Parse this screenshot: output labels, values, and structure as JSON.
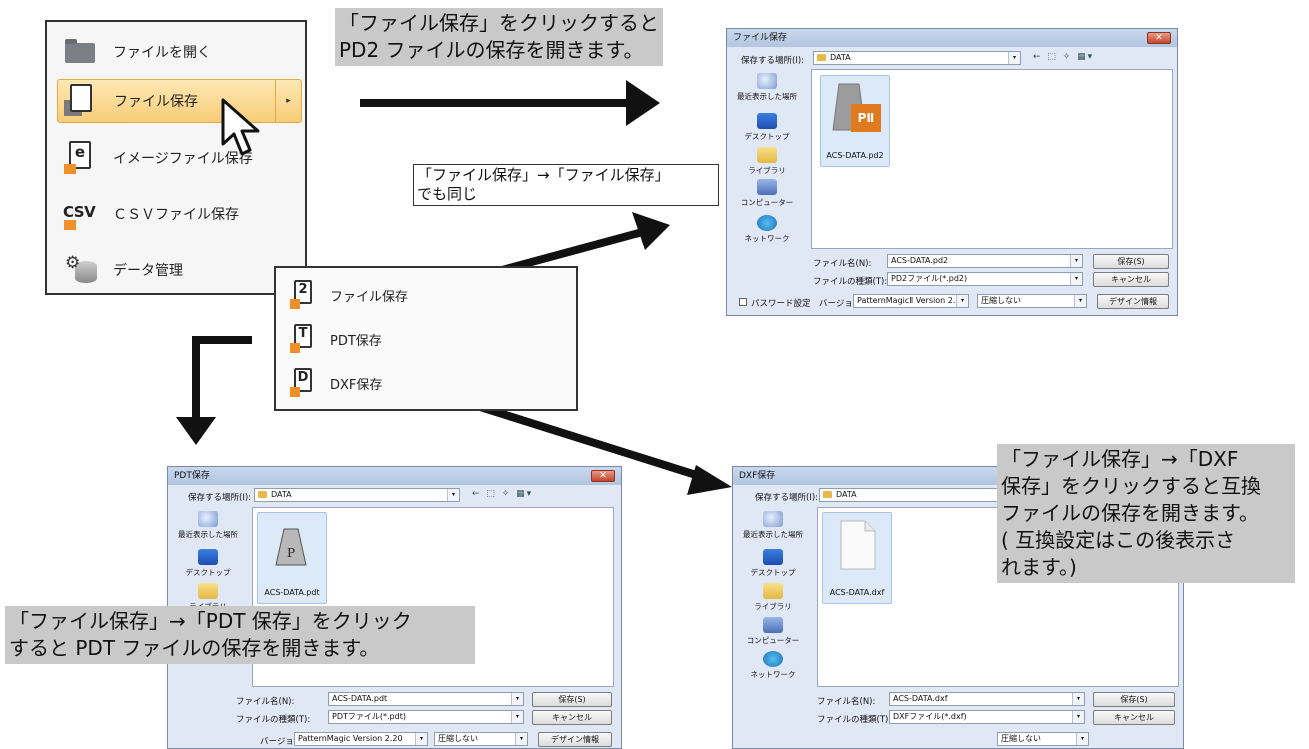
{
  "menu": {
    "items": [
      {
        "label": "ファイルを開く",
        "icon": "folder-icon"
      },
      {
        "label": "ファイル保存",
        "icon": "save-file-icon"
      },
      {
        "label": "イメージファイル保存",
        "icon": "image-file-icon",
        "glyph": "e"
      },
      {
        "label": "ＣＳＶファイル保存",
        "icon": "csv-file-icon",
        "glyph": "CSV"
      },
      {
        "label": "データ管理",
        "icon": "database-icon"
      }
    ],
    "submenu_arrow": "▸"
  },
  "submenu": {
    "items": [
      {
        "label": "ファイル保存",
        "glyph": "2"
      },
      {
        "label": "PDT保存",
        "glyph": "T"
      },
      {
        "label": "DXF保存",
        "glyph": "D"
      }
    ]
  },
  "callouts": {
    "top": {
      "line1": "「ファイル保存」をクリックすると",
      "line2": "PD2 ファイルの保存を開きます。"
    },
    "middle": {
      "line1": "「ファイル保存」→「ファイル保存」",
      "line2": "でも同じ"
    },
    "pdt": {
      "line1": "「ファイル保存」→「PDT 保存」をクリック",
      "line2": "すると PDT ファイルの保存を開きます。"
    },
    "dxf": {
      "line1": "「ファイル保存」→「DXF",
      "line2": "保存」をクリックすると互換",
      "line3": "ファイルの保存を開きます。",
      "line4": "( 互換設定はこの後表示さ",
      "line5": "れます。)"
    }
  },
  "places": {
    "recent": "最近表示した場所",
    "desktop": "デスクトップ",
    "library": "ライブラリ",
    "computer": "コンピューター",
    "network": "ネットワーク"
  },
  "dialogs": {
    "pd2": {
      "title": "ファイル保存",
      "location_label": "保存する場所(I):",
      "location_value": "DATA",
      "file_name": "ACS-DATA.pd2",
      "file_badge": "PⅡ",
      "filename_label": "ファイル名(N):",
      "filename_value": "ACS-DATA.pd2",
      "filetype_label": "ファイルの種類(T):",
      "filetype_value": "PD2ファイル(*.pd2)",
      "save_button": "保存(S)",
      "cancel_button": "キャンセル",
      "password_label": "パスワード設定",
      "version_label": "バージョン",
      "version_value": "PatternMagicⅡ Version 2.00",
      "compress_value": "圧縮しない",
      "design_button": "デザイン情報"
    },
    "pdt": {
      "title": "PDT保存",
      "location_label": "保存する場所(I):",
      "location_value": "DATA",
      "file_name": "ACS-DATA.pdt",
      "file_badge": "P",
      "filename_label": "ファイル名(N):",
      "filename_value": "ACS-DATA.pdt",
      "filetype_label": "ファイルの種類(T):",
      "filetype_value": "PDTファイル(*.pdt)",
      "save_button": "保存(S)",
      "cancel_button": "キャンセル",
      "version_label": "バージョン",
      "version_value": "PatternMagic Version 2.20",
      "compress_value": "圧縮しない",
      "design_button": "デザイン情報"
    },
    "dxf": {
      "title": "DXF保存",
      "location_label": "保存する場所(I):",
      "location_value": "DATA",
      "file_name": "ACS-DATA.dxf",
      "filename_label": "ファイル名(N):",
      "filename_value": "ACS-DATA.dxf",
      "filetype_label": "ファイルの種類(T):",
      "filetype_value": "DXFファイル(*.dxf)",
      "save_button": "保存(S)",
      "cancel_button": "キャンセル",
      "compress_value": "圧縮しない"
    }
  },
  "toolbar_icons": "← ⬚ ✧ ▦▾",
  "close_glyph": "✕",
  "dropdown_glyph": "▾"
}
